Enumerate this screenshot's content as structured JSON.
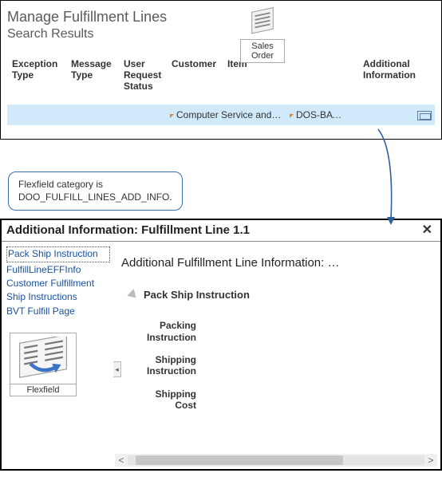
{
  "top": {
    "title": "Manage Fulfillment Lines",
    "subtitle": "Search Results",
    "sales_order_label": "Sales Order",
    "columns": {
      "exception": "Exception Type",
      "message": "Message Type",
      "user_request": "User Request Status",
      "customer": "Customer",
      "item": "Item",
      "additional": "Additional Information"
    },
    "row": {
      "customer": "Computer Service and R…",
      "item": "DOS-BAT…"
    }
  },
  "annotation": {
    "line1": "Flexfield category is",
    "line2": "DOO_FULFILL_LINES_ADD_INFO."
  },
  "dialog": {
    "title": "Additional Information: Fulfillment Line 1.1",
    "links": [
      "Pack Ship Instruction",
      "FulfillLineEFFInfo",
      "Customer Fulfillment",
      "Ship Instructions",
      "BVT Fulfill Page"
    ],
    "flexfield_label": "Flexfield",
    "content_title": "Additional Fulfillment Line Information: …",
    "section_label": "Pack Ship Instruction",
    "fields": {
      "packing": "Packing Instruction",
      "shipping_instr": "Shipping Instruction",
      "shipping_cost": "Shipping Cost"
    }
  }
}
